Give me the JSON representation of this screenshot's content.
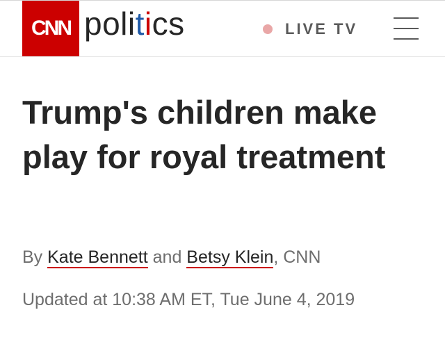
{
  "header": {
    "logo_text": "CNN",
    "section": {
      "part1": "poli",
      "part2": "t",
      "part3": "i",
      "part4": "cs"
    },
    "live_label": "LIVE TV",
    "menu_icon": "hamburger-menu-icon",
    "colors": {
      "brand_red": "#cc0000",
      "section_blue": "#1f5aa8",
      "live_dot": "#e9a7a7"
    }
  },
  "article": {
    "headline": "Trump's children make play for royal treatment",
    "byline": {
      "prefix": "By ",
      "author1": "Kate Bennett",
      "conjunction": " and ",
      "author2": "Betsy Klein",
      "suffix": ", CNN"
    },
    "updated": "Updated at 10:38 AM ET, Tue June 4, 2019"
  }
}
